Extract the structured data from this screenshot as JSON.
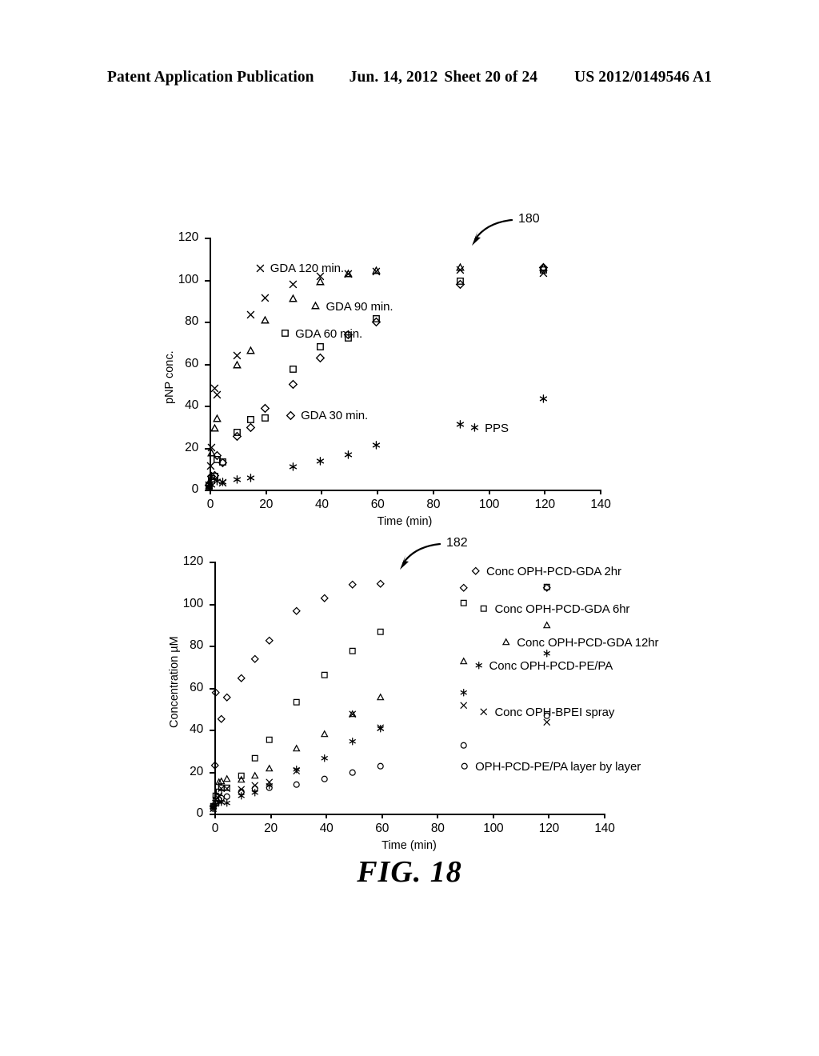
{
  "header": {
    "publication": "Patent Application Publication",
    "date": "Jun. 14, 2012",
    "sheet": "Sheet 20 of 24",
    "patent_number": "US 2012/0149546 A1"
  },
  "figure": {
    "caption": "FIG. 18"
  },
  "callouts": {
    "top": "180",
    "bottom": "182"
  },
  "chart_data": [
    {
      "id": "chart-1",
      "type": "scatter",
      "title": "",
      "xlabel": "Time (min)",
      "ylabel": "pNP conc.",
      "xlim": [
        0,
        140
      ],
      "ylim": [
        0,
        120
      ],
      "xticks": [
        0,
        20,
        40,
        60,
        80,
        100,
        120,
        140
      ],
      "yticks": [
        0,
        20,
        40,
        60,
        80,
        100,
        120
      ],
      "grid": false,
      "legend_position": "inline",
      "series": [
        {
          "name": "GDA 120 min.",
          "marker": "x",
          "label_x": 16,
          "label_y": 105,
          "points": [
            {
              "x": 0,
              "y": 2
            },
            {
              "x": 0.5,
              "y": 11
            },
            {
              "x": 1,
              "y": 20
            },
            {
              "x": 2,
              "y": 48
            },
            {
              "x": 3,
              "y": 45
            },
            {
              "x": 5,
              "y": 3
            },
            {
              "x": 10,
              "y": 63.5
            },
            {
              "x": 15,
              "y": 83
            },
            {
              "x": 20,
              "y": 91
            },
            {
              "x": 30,
              "y": 97.5
            },
            {
              "x": 40,
              "y": 101.5
            },
            {
              "x": 50,
              "y": 102.5
            },
            {
              "x": 60,
              "y": 103.5
            },
            {
              "x": 90,
              "y": 104.5
            },
            {
              "x": 120,
              "y": 103
            }
          ]
        },
        {
          "name": "GDA 90 min.",
          "marker": "triangle",
          "label_x": 36,
          "label_y": 87,
          "points": [
            {
              "x": 0,
              "y": 3
            },
            {
              "x": 1,
              "y": 17
            },
            {
              "x": 2,
              "y": 29
            },
            {
              "x": 3,
              "y": 33.5
            },
            {
              "x": 10,
              "y": 59
            },
            {
              "x": 15,
              "y": 66
            },
            {
              "x": 20,
              "y": 80.5
            },
            {
              "x": 30,
              "y": 90.5
            },
            {
              "x": 40,
              "y": 98.5
            },
            {
              "x": 50,
              "y": 102.5
            },
            {
              "x": 60,
              "y": 104
            },
            {
              "x": 90,
              "y": 105.5
            },
            {
              "x": 120,
              "y": 105.5
            }
          ]
        },
        {
          "name": "GDA 60 min.",
          "marker": "square",
          "label_x": 25,
          "label_y": 74,
          "points": [
            {
              "x": 0,
              "y": 1.5
            },
            {
              "x": 1,
              "y": 5
            },
            {
              "x": 2,
              "y": 6
            },
            {
              "x": 3,
              "y": 14
            },
            {
              "x": 5,
              "y": 13
            },
            {
              "x": 10,
              "y": 27
            },
            {
              "x": 15,
              "y": 33
            },
            {
              "x": 20,
              "y": 34
            },
            {
              "x": 30,
              "y": 57
            },
            {
              "x": 40,
              "y": 68
            },
            {
              "x": 50,
              "y": 72
            },
            {
              "x": 60,
              "y": 81
            },
            {
              "x": 90,
              "y": 99
            },
            {
              "x": 120,
              "y": 104.5
            }
          ]
        },
        {
          "name": "GDA 30 min.",
          "marker": "diamond",
          "label_x": 27,
          "label_y": 35,
          "points": [
            {
              "x": 0,
              "y": 2
            },
            {
              "x": 1,
              "y": 6
            },
            {
              "x": 2,
              "y": 6.5
            },
            {
              "x": 3,
              "y": 16
            },
            {
              "x": 5,
              "y": 12.5
            },
            {
              "x": 10,
              "y": 25
            },
            {
              "x": 15,
              "y": 29.5
            },
            {
              "x": 20,
              "y": 38.5
            },
            {
              "x": 30,
              "y": 50
            },
            {
              "x": 40,
              "y": 62.5
            },
            {
              "x": 50,
              "y": 73.5
            },
            {
              "x": 60,
              "y": 79.5
            },
            {
              "x": 90,
              "y": 97.5
            },
            {
              "x": 120,
              "y": 105.5
            }
          ]
        },
        {
          "name": "PPS",
          "marker": "star",
          "label_x": 93,
          "label_y": 29,
          "points": [
            {
              "x": 0,
              "y": 1
            },
            {
              "x": 1,
              "y": 2
            },
            {
              "x": 3,
              "y": 4
            },
            {
              "x": 5,
              "y": 3.5
            },
            {
              "x": 10,
              "y": 4.5
            },
            {
              "x": 15,
              "y": 5.5
            },
            {
              "x": 30,
              "y": 10.5
            },
            {
              "x": 40,
              "y": 13.5
            },
            {
              "x": 50,
              "y": 16.5
            },
            {
              "x": 60,
              "y": 21
            },
            {
              "x": 90,
              "y": 31
            },
            {
              "x": 120,
              "y": 43
            }
          ]
        }
      ]
    },
    {
      "id": "chart-2",
      "type": "scatter",
      "title": "",
      "xlabel": "Time (min)",
      "ylabel": "Concentration µM",
      "xlim": [
        0,
        140
      ],
      "ylim": [
        0,
        120
      ],
      "xticks": [
        0,
        20,
        40,
        60,
        80,
        100,
        120,
        140
      ],
      "yticks": [
        0,
        20,
        40,
        60,
        80,
        100,
        120
      ],
      "grid": false,
      "legend_position": "inline-right",
      "series": [
        {
          "name": "Conc OPH-PCD-GDA 2hr",
          "marker": "diamond",
          "label_x": 92,
          "label_y": 115,
          "points": [
            {
              "x": 0,
              "y": 3
            },
            {
              "x": 0.5,
              "y": 22.5
            },
            {
              "x": 1,
              "y": 57
            },
            {
              "x": 3,
              "y": 44.5
            },
            {
              "x": 5,
              "y": 55
            },
            {
              "x": 10,
              "y": 64
            },
            {
              "x": 15,
              "y": 73
            },
            {
              "x": 20,
              "y": 82
            },
            {
              "x": 30,
              "y": 96
            },
            {
              "x": 40,
              "y": 102
            },
            {
              "x": 50,
              "y": 108.5
            },
            {
              "x": 60,
              "y": 109
            },
            {
              "x": 90,
              "y": 107
            },
            {
              "x": 120,
              "y": 107
            }
          ]
        },
        {
          "name": "Conc OPH-PCD-GDA 6hr",
          "marker": "square",
          "label_x": 95,
          "label_y": 97,
          "points": [
            {
              "x": 0,
              "y": 3
            },
            {
              "x": 1,
              "y": 8
            },
            {
              "x": 2,
              "y": 10
            },
            {
              "x": 3,
              "y": 12
            },
            {
              "x": 5,
              "y": 12
            },
            {
              "x": 10,
              "y": 17.5
            },
            {
              "x": 15,
              "y": 26
            },
            {
              "x": 20,
              "y": 34.5
            },
            {
              "x": 30,
              "y": 52.5
            },
            {
              "x": 40,
              "y": 65.5
            },
            {
              "x": 50,
              "y": 77
            },
            {
              "x": 60,
              "y": 86
            },
            {
              "x": 90,
              "y": 100
            },
            {
              "x": 120,
              "y": 107.5
            }
          ]
        },
        {
          "name": "Conc OPH-PCD-GDA 12hr",
          "marker": "triangle",
          "label_x": 103,
          "label_y": 81,
          "points": [
            {
              "x": 0,
              "y": 3
            },
            {
              "x": 1,
              "y": 7
            },
            {
              "x": 2,
              "y": 14.5
            },
            {
              "x": 3,
              "y": 15
            },
            {
              "x": 5,
              "y": 16
            },
            {
              "x": 10,
              "y": 15.5
            },
            {
              "x": 15,
              "y": 17.5
            },
            {
              "x": 20,
              "y": 21
            },
            {
              "x": 30,
              "y": 30.5
            },
            {
              "x": 40,
              "y": 37.5
            },
            {
              "x": 50,
              "y": 47
            },
            {
              "x": 60,
              "y": 55
            },
            {
              "x": 90,
              "y": 72
            },
            {
              "x": 120,
              "y": 89
            }
          ]
        },
        {
          "name": "Conc OPH-PCD-PE/PA",
          "marker": "star",
          "label_x": 93,
          "label_y": 70,
          "points": [
            {
              "x": 0,
              "y": 2.5
            },
            {
              "x": 1,
              "y": 4
            },
            {
              "x": 2,
              "y": 5
            },
            {
              "x": 3,
              "y": 5
            },
            {
              "x": 5,
              "y": 4.5
            },
            {
              "x": 10,
              "y": 8
            },
            {
              "x": 15,
              "y": 9.5
            },
            {
              "x": 20,
              "y": 13
            },
            {
              "x": 30,
              "y": 20.5
            },
            {
              "x": 40,
              "y": 26
            },
            {
              "x": 50,
              "y": 34
            },
            {
              "x": 60,
              "y": 40
            },
            {
              "x": 90,
              "y": 57
            },
            {
              "x": 120,
              "y": 76
            }
          ]
        },
        {
          "name": "Conc OPH-BPEI spray",
          "marker": "x",
          "label_x": 95,
          "label_y": 48,
          "points": [
            {
              "x": 0,
              "y": 2
            },
            {
              "x": 1,
              "y": 6
            },
            {
              "x": 2,
              "y": 8
            },
            {
              "x": 3,
              "y": 11.5
            },
            {
              "x": 5,
              "y": 11.5
            },
            {
              "x": 10,
              "y": 11
            },
            {
              "x": 15,
              "y": 13
            },
            {
              "x": 20,
              "y": 14.5
            },
            {
              "x": 30,
              "y": 20
            },
            {
              "x": 50,
              "y": 47
            },
            {
              "x": 60,
              "y": 40.5
            },
            {
              "x": 90,
              "y": 51
            },
            {
              "x": 120,
              "y": 43
            }
          ]
        },
        {
          "name": "OPH-PCD-PE/PA layer by layer",
          "marker": "circle",
          "label_x": 88,
          "label_y": 22,
          "points": [
            {
              "x": 0,
              "y": 2
            },
            {
              "x": 1,
              "y": 4.5
            },
            {
              "x": 2,
              "y": 6
            },
            {
              "x": 3,
              "y": 7
            },
            {
              "x": 5,
              "y": 7.5
            },
            {
              "x": 10,
              "y": 10
            },
            {
              "x": 15,
              "y": 11.5
            },
            {
              "x": 20,
              "y": 12
            },
            {
              "x": 30,
              "y": 13.5
            },
            {
              "x": 40,
              "y": 16
            },
            {
              "x": 50,
              "y": 19
            },
            {
              "x": 60,
              "y": 22
            },
            {
              "x": 90,
              "y": 32
            },
            {
              "x": 120,
              "y": 46
            }
          ]
        }
      ]
    }
  ]
}
